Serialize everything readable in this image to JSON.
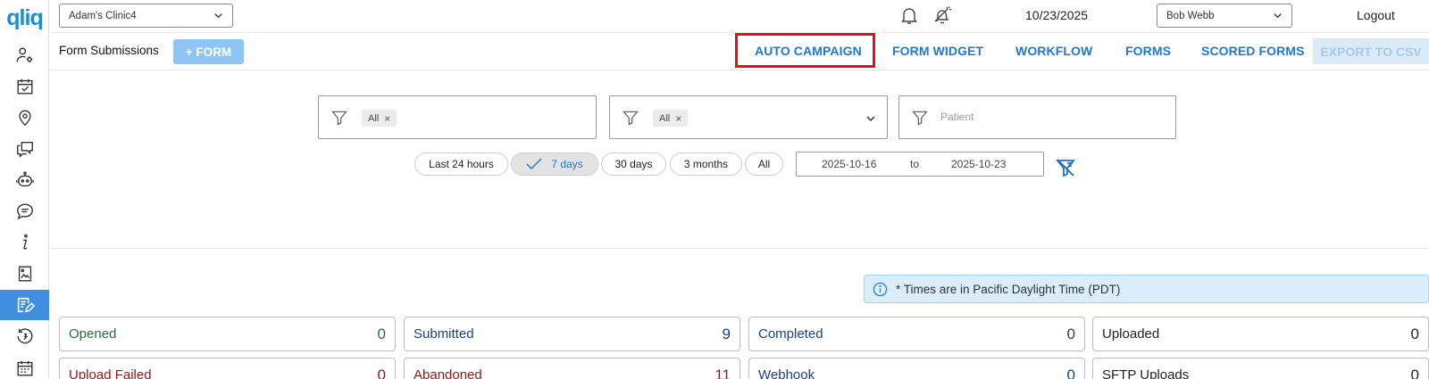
{
  "app": {
    "logo": "qliq"
  },
  "topbar": {
    "clinic": "Adam's Clinic4",
    "date": "10/23/2025",
    "user": "Bob Webb",
    "logout": "Logout"
  },
  "subbar": {
    "title": "Form Submissions",
    "add_form": "+ FORM",
    "nav": [
      "AUTO CAMPAIGN",
      "FORM WIDGET",
      "WORKFLOW",
      "FORMS",
      "SCORED FORMS"
    ],
    "export": "EXPORT TO CSV"
  },
  "filters": {
    "chip1": "All",
    "chip2": "All",
    "chip_remove": "×",
    "patient_placeholder": "Patient"
  },
  "time_range": {
    "options": [
      "Last 24 hours",
      "7 days",
      "30 days",
      "3 months",
      "All"
    ],
    "selected": "7 days",
    "from": "2025-10-16",
    "to_word": "to",
    "to": "2025-10-23"
  },
  "notice": "* Times are in Pacific Daylight Time (PDT)",
  "stats": [
    {
      "label": "Opened",
      "value": "0"
    },
    {
      "label": "Submitted",
      "value": "9"
    },
    {
      "label": "Completed",
      "value": "0"
    },
    {
      "label": "Uploaded",
      "value": "0"
    },
    {
      "label": "Upload Failed",
      "value": "0"
    },
    {
      "label": "Abandoned",
      "value": "11"
    },
    {
      "label": "Webhook",
      "value": "0"
    },
    {
      "label": "SFTP Uploads",
      "value": "0"
    }
  ],
  "colors": {
    "accent": "#1f78d0",
    "highlight": "#e01016",
    "opened": "#2e6b3a",
    "submitted": "#1d3f7a",
    "completed": "#1d3f7a",
    "uploaded": "#222222",
    "failed": "#8b1a1a",
    "abandoned": "#8b1a1a"
  }
}
